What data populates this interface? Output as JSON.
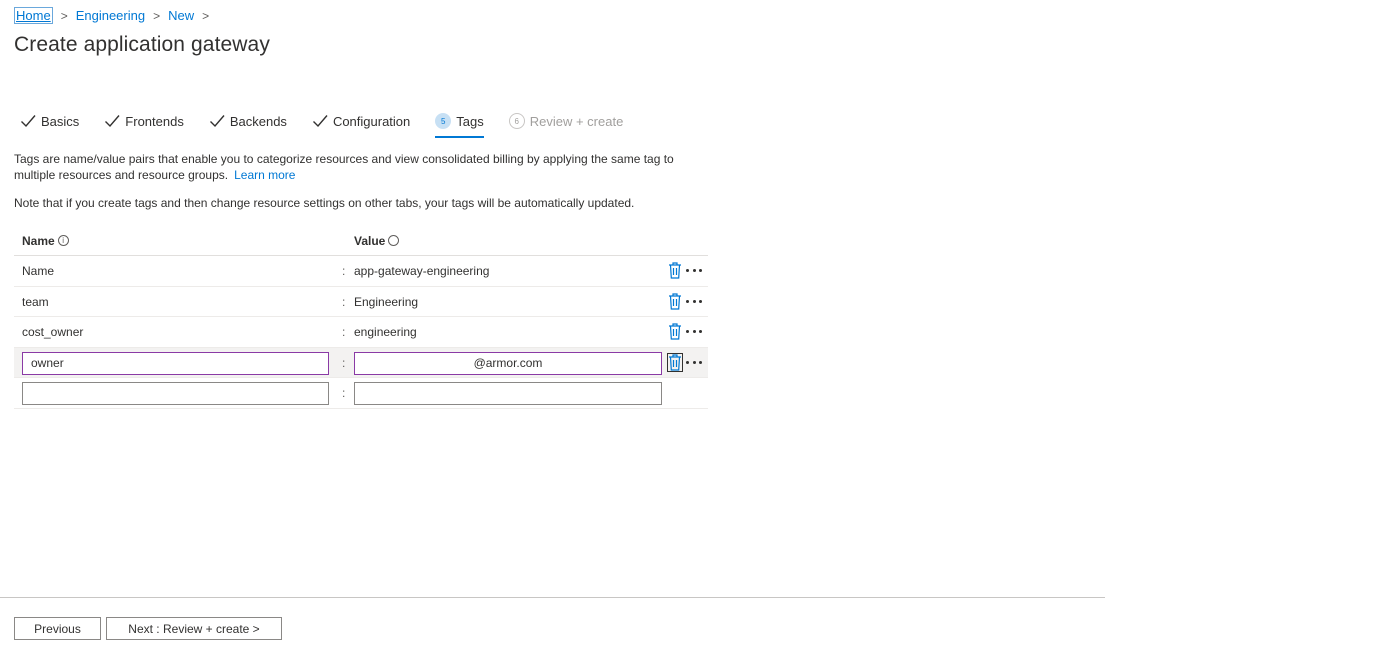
{
  "breadcrumb": {
    "items": [
      "Home",
      "Engineering",
      "New"
    ]
  },
  "page": {
    "title": "Create application gateway"
  },
  "tabs": [
    {
      "label": "Basics",
      "state": "complete"
    },
    {
      "label": "Frontends",
      "state": "complete"
    },
    {
      "label": "Backends",
      "state": "complete"
    },
    {
      "label": "Configuration",
      "state": "complete"
    },
    {
      "label": "Tags",
      "state": "active",
      "number": "5"
    },
    {
      "label": "Review + create",
      "state": "disabled",
      "number": "6"
    }
  ],
  "description": {
    "text": "Tags are name/value pairs that enable you to categorize resources and view consolidated billing by applying the same tag to multiple resources and resource groups.",
    "learn_more": "Learn more",
    "note": "Note that if you create tags and then change resource settings on other tabs, your tags will be automatically updated."
  },
  "tag_table": {
    "name_header": "Name",
    "value_header": "Value",
    "rows": [
      {
        "name": "Name",
        "value": "app-gateway-engineering"
      },
      {
        "name": "team",
        "value": "Engineering"
      },
      {
        "name": "cost_owner",
        "value": "engineering"
      }
    ],
    "editing_row": {
      "name": "owner",
      "value": "@armor.com"
    },
    "empty_row": {
      "name": "",
      "value": ""
    },
    "separator": ":"
  },
  "footer": {
    "previous_label": "Previous",
    "next_label": "Next : Review + create >"
  },
  "colors": {
    "accent": "#0078d4",
    "focus_border": "#8a3aa5",
    "text": "#323130"
  }
}
